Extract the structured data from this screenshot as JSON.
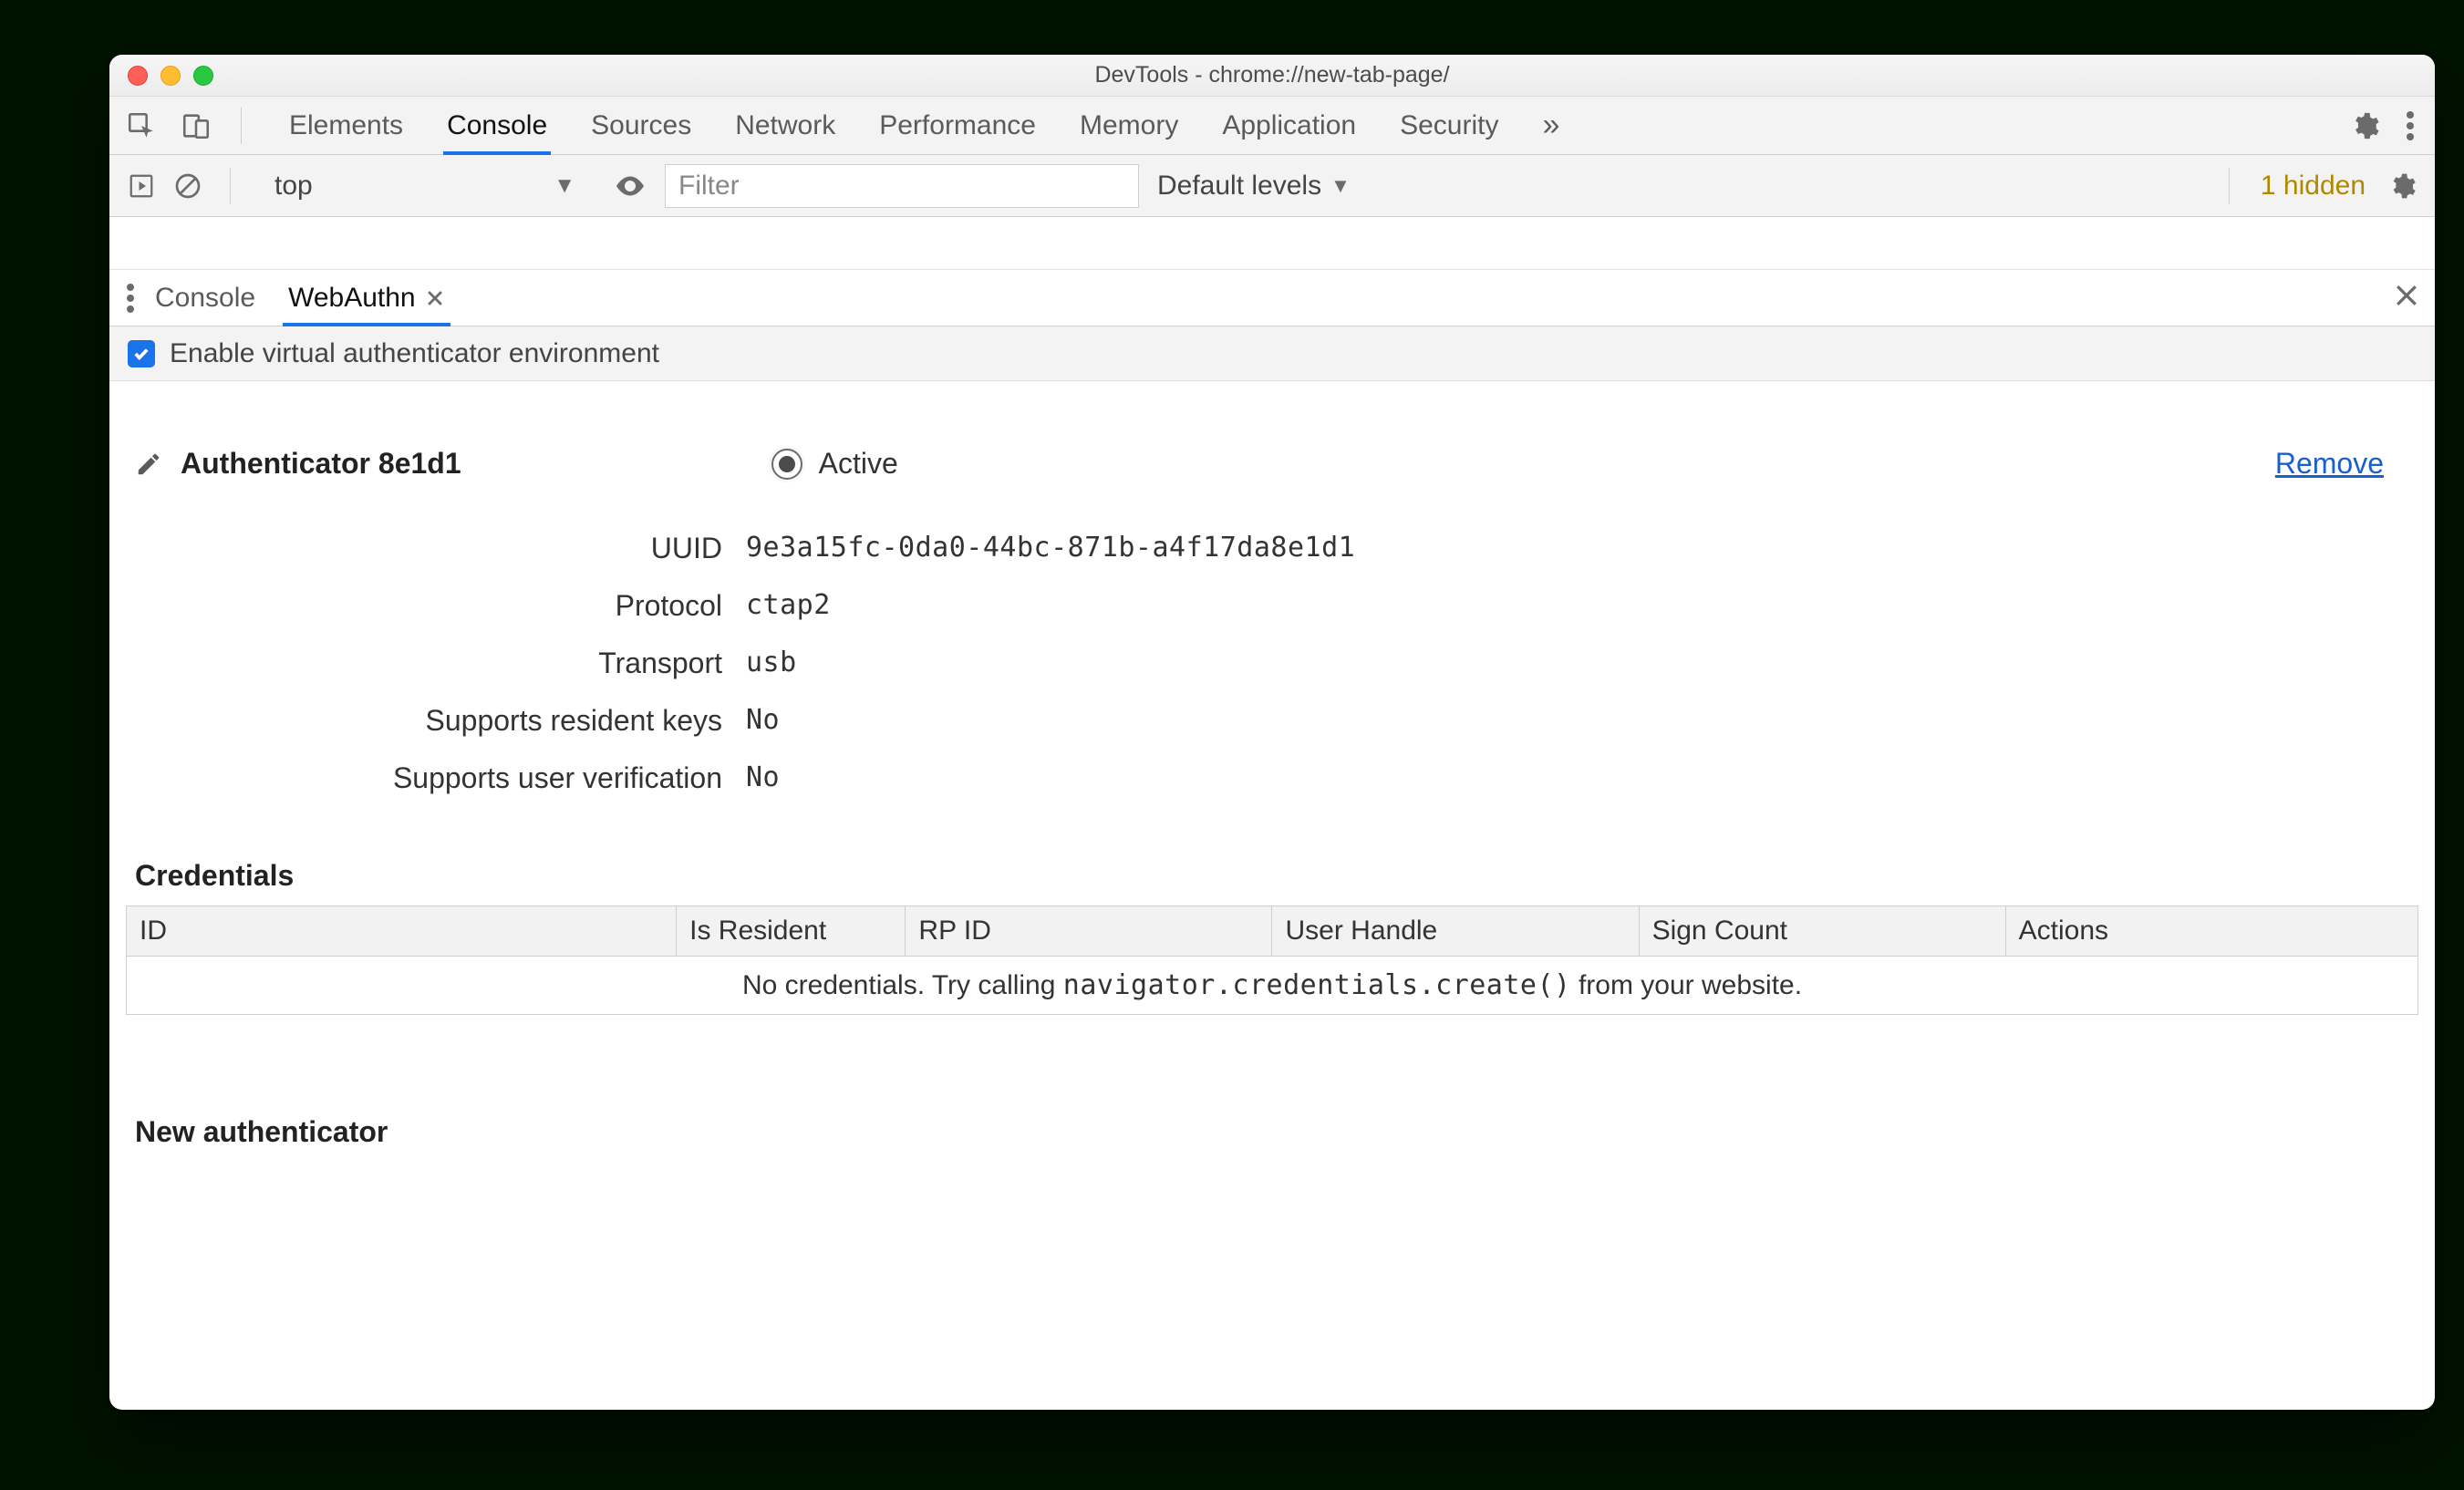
{
  "window": {
    "title": "DevTools - chrome://new-tab-page/"
  },
  "mainTabs": {
    "items": [
      "Elements",
      "Console",
      "Sources",
      "Network",
      "Performance",
      "Memory",
      "Application",
      "Security"
    ],
    "activeIndex": 1,
    "moreTabs": "»"
  },
  "consoleBar": {
    "context": "top",
    "filterPlaceholder": "Filter",
    "levels": "Default levels",
    "hidden": "1 hidden"
  },
  "drawer": {
    "tabs": [
      "Console",
      "WebAuthn"
    ],
    "activeIndex": 1
  },
  "enable": {
    "checked": true,
    "label": "Enable virtual authenticator environment"
  },
  "authenticator": {
    "editLabel": "edit",
    "title": "Authenticator 8e1d1",
    "activeLabel": "Active",
    "removeLabel": "Remove",
    "fields": {
      "uuid": {
        "label": "UUID",
        "value": "9e3a15fc-0da0-44bc-871b-a4f17da8e1d1"
      },
      "protocol": {
        "label": "Protocol",
        "value": "ctap2"
      },
      "transport": {
        "label": "Transport",
        "value": "usb"
      },
      "resident": {
        "label": "Supports resident keys",
        "value": "No"
      },
      "userver": {
        "label": "Supports user verification",
        "value": "No"
      }
    }
  },
  "credentials": {
    "heading": "Credentials",
    "columns": [
      "ID",
      "Is Resident",
      "RP ID",
      "User Handle",
      "Sign Count",
      "Actions"
    ],
    "emptyPrefix": "No credentials. Try calling ",
    "emptyCode": "navigator.credentials.create()",
    "emptySuffix": " from your website."
  },
  "newAuth": {
    "heading": "New authenticator"
  }
}
